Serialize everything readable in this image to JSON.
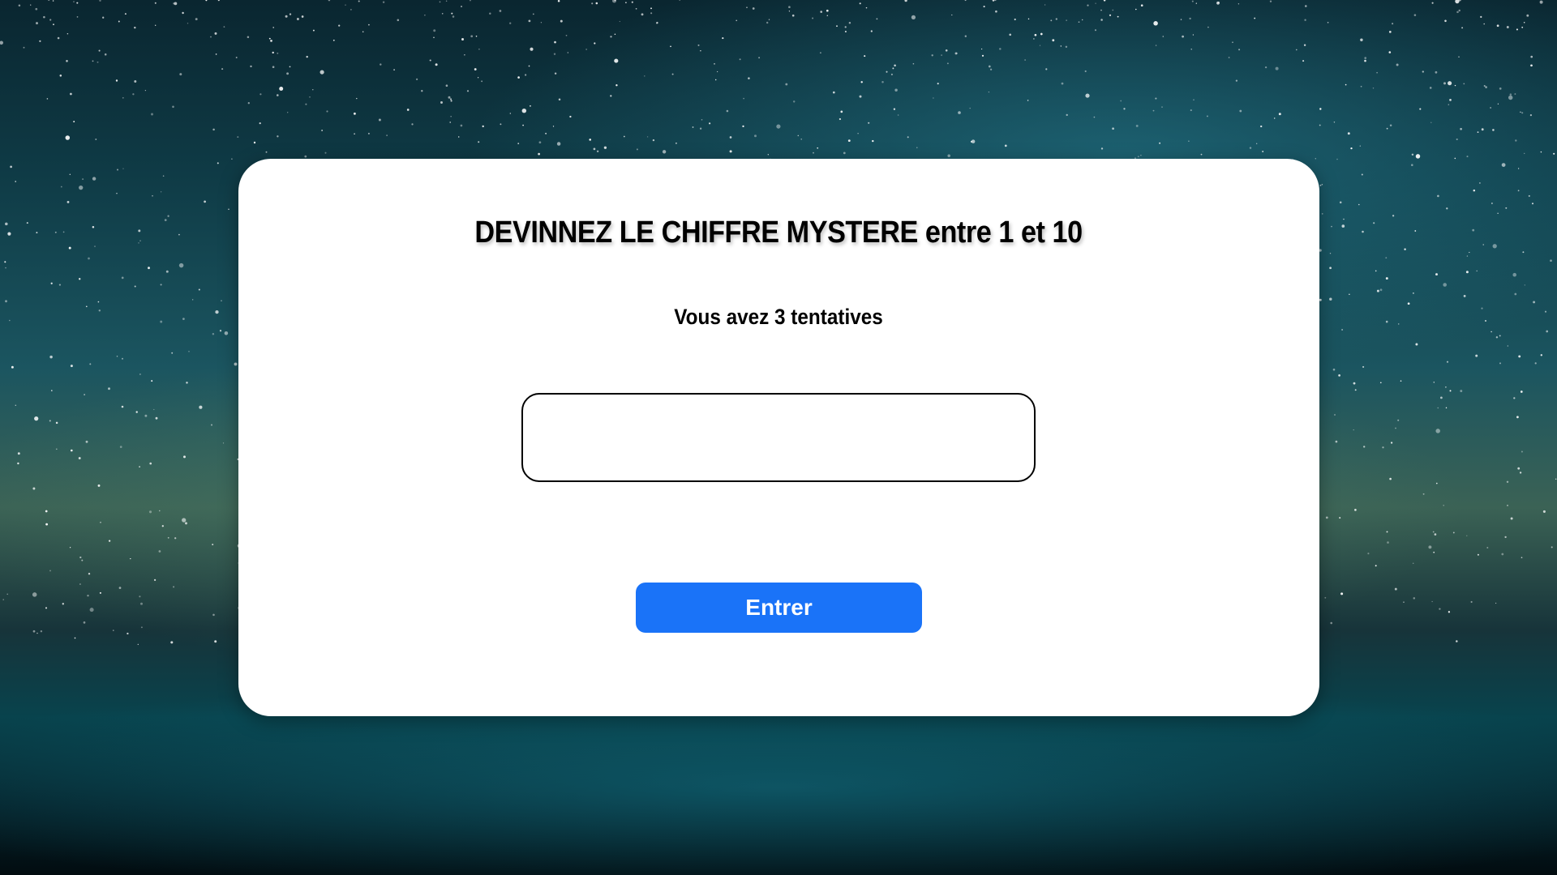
{
  "game": {
    "title": "DEVINNEZ LE CHIFFRE MYSTERE entre 1 et 10",
    "attempts_text": "Vous avez 3 tentatives",
    "guess_input": {
      "value": "",
      "placeholder": ""
    },
    "enter_label": "Entrer"
  },
  "colors": {
    "card_background": "#ffffff",
    "button_background": "#1a73f8",
    "button_text": "#ffffff",
    "text": "#000000"
  }
}
